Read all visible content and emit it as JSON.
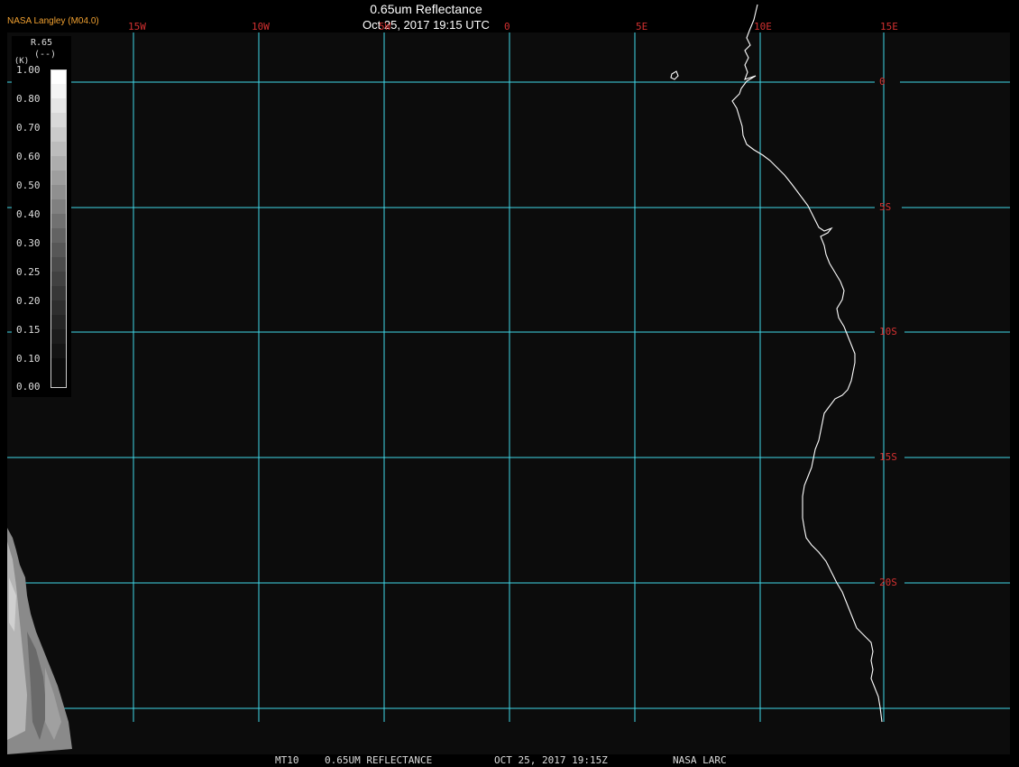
{
  "header": {
    "title": "0.65um Reflectance",
    "datetime": "Oct 25, 2017 19:15 UTC",
    "org": "NASA Langley (M04.0)"
  },
  "map": {
    "longitude_labels": [
      "15W",
      "10W",
      "5W",
      "0",
      "5E",
      "10E",
      "15E"
    ],
    "latitude_labels": [
      "0",
      "5S",
      "10S",
      "15S",
      "20S"
    ],
    "grid_color": "#40d8e8",
    "label_color": "#d23030",
    "coastline_color": "#ffffff"
  },
  "legend": {
    "variable": "R.65",
    "units": "(--)",
    "marker": "(K)",
    "ticks": [
      "1.00",
      "0.80",
      "0.70",
      "0.60",
      "0.50",
      "0.40",
      "0.30",
      "0.25",
      "0.20",
      "0.15",
      "0.10",
      "0.00"
    ]
  },
  "footer": {
    "satellite": "MT10",
    "product": "0.65UM REFLECTANCE",
    "timestamp": "OCT 25, 2017 19:15Z",
    "source": "NASA LARC"
  }
}
